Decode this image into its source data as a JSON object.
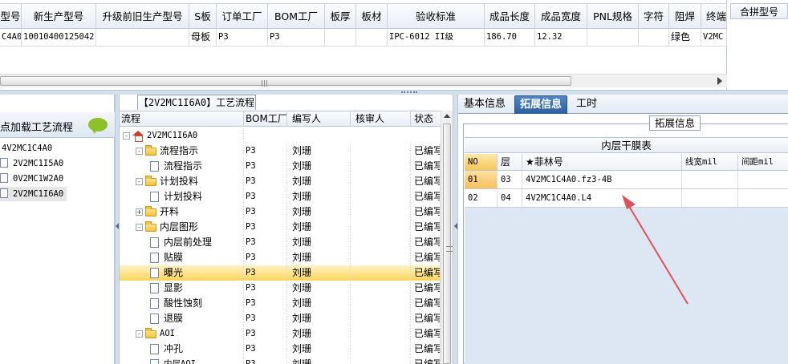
{
  "top_grid": {
    "headers": [
      "型号",
      "新生产型号",
      "升级前旧生产型号",
      "S板",
      "订单工厂",
      "BOM工厂",
      "板厚",
      "板材",
      "验收标准",
      "成品长度",
      "成品宽度",
      "PNL规格",
      "字符",
      "阻焊",
      "终端"
    ],
    "row": [
      "C4A0",
      "10010400125042",
      "",
      "母板",
      "P3",
      "P3",
      "",
      "",
      "IPC-6012 II级",
      "186.70",
      "12.32",
      "",
      "",
      "绿色",
      "V2MC"
    ]
  },
  "merge_panel": {
    "header": "合拼型号"
  },
  "left_tree": {
    "title": "点加载工艺流程",
    "items": [
      "4V2MC1C4A0",
      "2V2MC1I5A0",
      "0V2MC1W2A0",
      "2V2MC1I6A0"
    ],
    "selected_index": 3
  },
  "process": {
    "tab_label": "【2V2MC1I6A0】工艺流程",
    "headers": [
      "流程",
      "BOM工厂",
      "编写人",
      "核审人",
      "状态"
    ],
    "root": "2V2MC1I6A0",
    "rows": [
      {
        "name": "流程指示",
        "level": 1,
        "type": "folder",
        "toggle": "-",
        "bom": "P3",
        "writer": "刘珊",
        "reviewer": "",
        "status": "已编写"
      },
      {
        "name": "流程指示",
        "level": 2,
        "type": "doc",
        "toggle": "",
        "bom": "P3",
        "writer": "刘珊",
        "reviewer": "",
        "status": "已编写"
      },
      {
        "name": "计划投料",
        "level": 1,
        "type": "folder",
        "toggle": "-",
        "bom": "P3",
        "writer": "刘珊",
        "reviewer": "",
        "status": "已编写"
      },
      {
        "name": "计划投料",
        "level": 2,
        "type": "doc",
        "toggle": "",
        "bom": "P3",
        "writer": "刘珊",
        "reviewer": "",
        "status": "已编写"
      },
      {
        "name": "开料",
        "level": 1,
        "type": "folder",
        "toggle": "+",
        "bom": "P3",
        "writer": "刘珊",
        "reviewer": "",
        "status": "已编写"
      },
      {
        "name": "内层图形",
        "level": 1,
        "type": "folder",
        "toggle": "-",
        "bom": "P3",
        "writer": "刘珊",
        "reviewer": "",
        "status": "已编写"
      },
      {
        "name": "内层前处理",
        "level": 2,
        "type": "doc",
        "toggle": "",
        "bom": "P3",
        "writer": "刘珊",
        "reviewer": "",
        "status": "已编写"
      },
      {
        "name": "贴膜",
        "level": 2,
        "type": "doc",
        "toggle": "",
        "bom": "P3",
        "writer": "刘珊",
        "reviewer": "",
        "status": "已编写"
      },
      {
        "name": "曝光",
        "level": 2,
        "type": "doc",
        "toggle": "",
        "bom": "P3",
        "writer": "刘珊",
        "reviewer": "",
        "status": "已编写"
      },
      {
        "name": "显影",
        "level": 2,
        "type": "doc",
        "toggle": "",
        "bom": "P3",
        "writer": "刘珊",
        "reviewer": "",
        "status": "已编写"
      },
      {
        "name": "酸性蚀刻",
        "level": 2,
        "type": "doc",
        "toggle": "",
        "bom": "P3",
        "writer": "刘珊",
        "reviewer": "",
        "status": "已编写"
      },
      {
        "name": "退膜",
        "level": 2,
        "type": "doc",
        "toggle": "",
        "bom": "P3",
        "writer": "刘珊",
        "reviewer": "",
        "status": "已编写"
      },
      {
        "name": "AOI",
        "level": 1,
        "type": "folder",
        "toggle": "-",
        "bom": "P3",
        "writer": "刘珊",
        "reviewer": "",
        "status": "已编写"
      },
      {
        "name": "冲孔",
        "level": 2,
        "type": "doc",
        "toggle": "",
        "bom": "P3",
        "writer": "刘珊",
        "reviewer": "",
        "status": "已编写"
      },
      {
        "name": "内层AOI",
        "level": 2,
        "type": "doc",
        "toggle": "",
        "bom": "P3",
        "writer": "刘珊",
        "reviewer": "",
        "status": "已编写"
      }
    ],
    "selected_index": 8
  },
  "info": {
    "tabs": [
      "基本信息",
      "拓展信息",
      "工时"
    ],
    "active_tab_index": 1,
    "group_title": "拓展信息",
    "table_title": "内层干膜表",
    "headers": [
      "NO",
      "层",
      "★菲林号",
      "线宽mil",
      "间距mil"
    ],
    "rows": [
      [
        "01",
        "03",
        "4V2MC1C4A0.fz3-4B",
        "",
        ""
      ],
      [
        "02",
        "04",
        "4V2MC1C4A0.L4",
        "",
        ""
      ]
    ],
    "selected_row": 0
  },
  "colors": {
    "selection": "#ffd65c",
    "accent": "#2c5f9e",
    "annotation": "#e0505a",
    "chat_bubble": "#8ec02b"
  }
}
